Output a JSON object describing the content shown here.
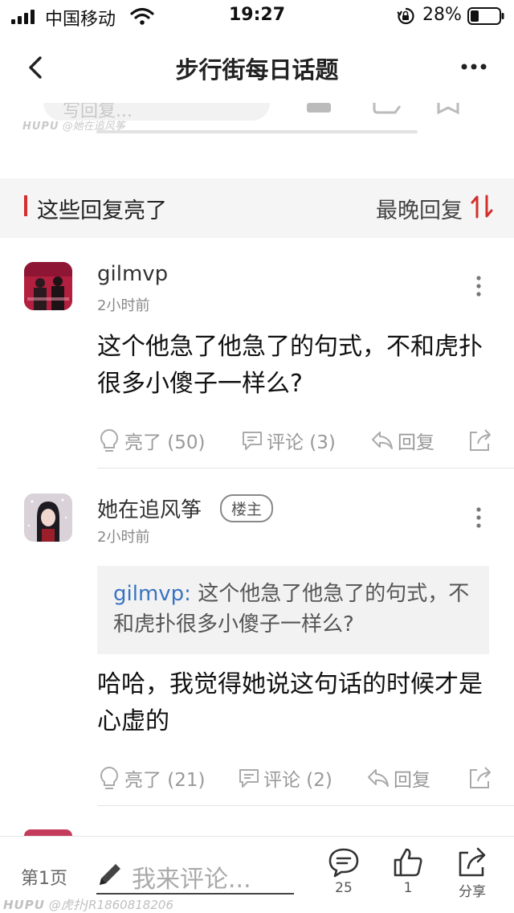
{
  "status_bar": {
    "carrier": "中国移动",
    "time": "19:27",
    "battery_percent": "28%"
  },
  "nav": {
    "title": "步行街每日话题"
  },
  "cut_content": {
    "input_placeholder_partial": "写回复...",
    "watermark_brand": "HUPU",
    "watermark_user": "@她在追风筝"
  },
  "section": {
    "title": "这些回复亮了",
    "sort_label": "最晚回复"
  },
  "comments": [
    {
      "username": "gilmvp",
      "time": "2小时前",
      "text": "这个他急了他急了的句式，不和虎扑很多小傻子一样么?",
      "light_label": "亮了 (50)",
      "comment_label": "评论 (3)",
      "reply_label": "回复"
    },
    {
      "username": "她在追风筝",
      "badge": "楼主",
      "time": "2小时前",
      "quote_user": "gilmvp:",
      "quote_text": "这个他急了他急了的句式，不和虎扑很多小傻子一样么?",
      "text": "哈哈，我觉得她说这句话的时候才是心虚的",
      "light_label": "亮了 (21)",
      "comment_label": "评论 (2)",
      "reply_label": "回复"
    }
  ],
  "bottom_bar": {
    "page_label": "第1页",
    "comment_placeholder": "我来评论...",
    "comments_count": "25",
    "likes_count": "1",
    "share_label": "分享",
    "watermark_brand": "HUPU",
    "watermark_user": "@虎扑JR1860818206"
  },
  "colors": {
    "accent_red": "#d32f2f",
    "quote_blue": "#3a73c2",
    "section_bg": "#f5f5f5"
  },
  "icons": [
    "signal-icon",
    "wifi-icon",
    "rotation-lock-icon",
    "battery-icon",
    "back-icon",
    "more-icon",
    "sort-icon",
    "lightbulb-icon",
    "comment-bubble-icon",
    "reply-icon",
    "share-icon",
    "pencil-icon",
    "thumbs-up-icon"
  ]
}
